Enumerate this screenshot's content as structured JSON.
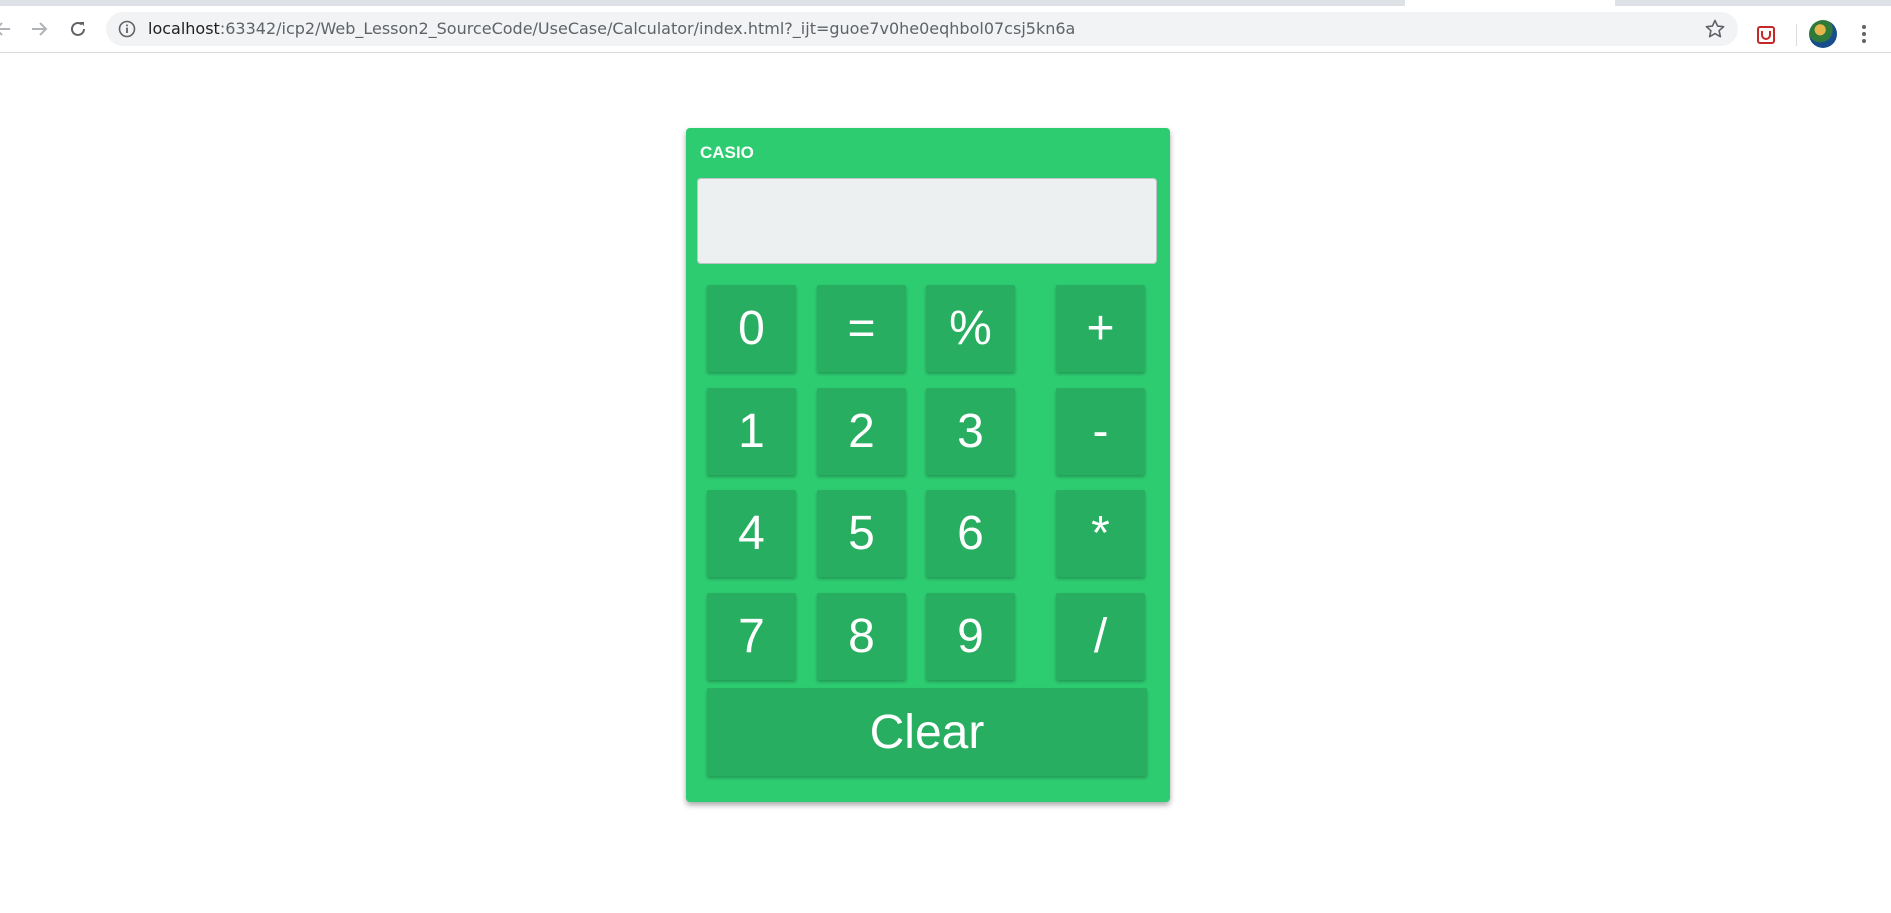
{
  "browser": {
    "url_host": "localhost",
    "url_rest": ":63342/icp2/Web_Lesson2_SourceCode/UseCase/Calculator/index.html?_ijt=guoe7v0he0eqhbol07csj5kn6a"
  },
  "calculator": {
    "brand": "CASIO",
    "display_value": "",
    "keys": {
      "zero": "0",
      "equals": "=",
      "percent": "%",
      "plus": "+",
      "one": "1",
      "two": "2",
      "three": "3",
      "minus": "-",
      "four": "4",
      "five": "5",
      "six": "6",
      "multiply": "*",
      "seven": "7",
      "eight": "8",
      "nine": "9",
      "divide": "/",
      "clear": "Clear"
    }
  },
  "colors": {
    "calculator_bg": "#2ecc71",
    "key_bg": "#27ae60",
    "display_bg": "#ecf0f1"
  },
  "icons": {
    "back": "back-arrow-icon",
    "forward": "forward-arrow-icon",
    "reload": "reload-icon",
    "info": "info-icon",
    "bookmark": "star-icon",
    "extension": "extension-icon",
    "profile": "avatar",
    "menu": "kebab-menu-icon"
  }
}
